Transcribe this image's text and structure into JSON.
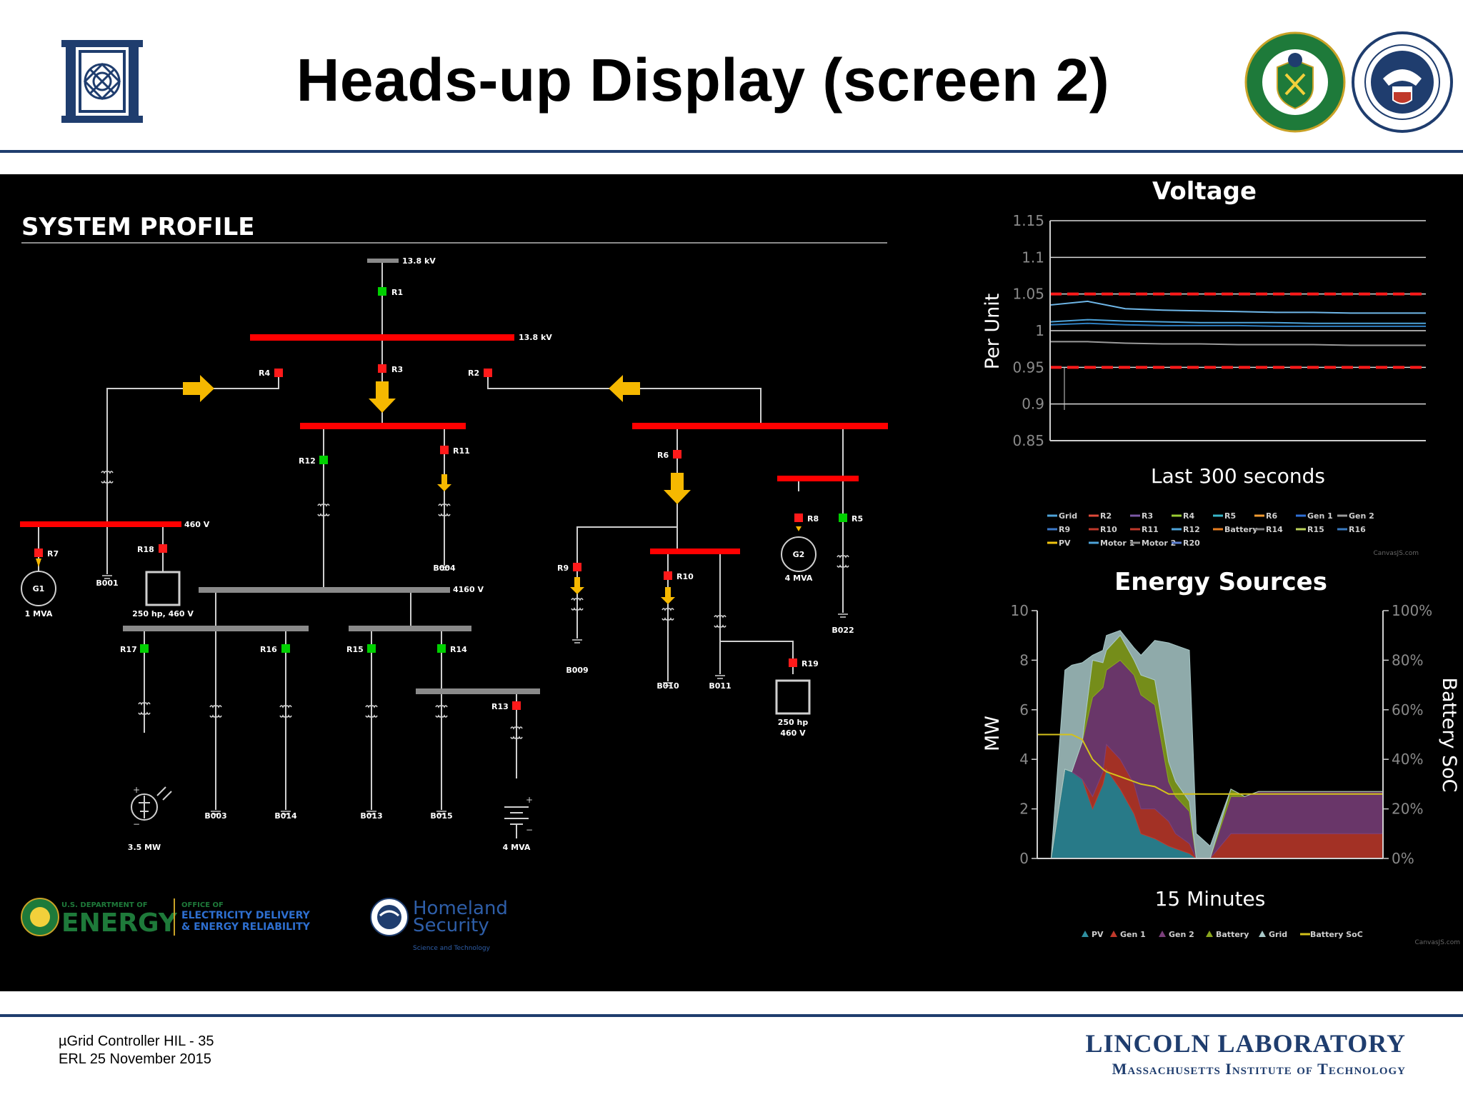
{
  "slide": {
    "title": "Heads-up Display (screen 2)",
    "footer_line1": "µGrid Controller HIL - 35",
    "footer_line2": "ERL 25 November 2015",
    "lab_name": "LINCOLN LABORATORY",
    "lab_subtitle": "Massachusetts Institute of Technology"
  },
  "colors": {
    "accent_navy": "#1f3d6e",
    "bus_energized": "#ff0000",
    "bus_deenergized": "#8a8a8a",
    "breaker_closed": "#00d000",
    "breaker_open": "#ff1a1a",
    "flow_arrow": "#f5b800"
  },
  "system_profile": {
    "title": "SYSTEM PROFILE",
    "labels": {
      "kv138_top": "13.8 kV",
      "kv138_main": "13.8 kV",
      "v460": "460 V",
      "v4160": "4160 V",
      "g1": "G1",
      "g1_rating": "1 MVA",
      "g2": "G2",
      "g2_rating": "4 MVA",
      "motor1_rating": "250 hp, 460 V",
      "motor2_rating_l1": "250 hp",
      "motor2_rating_l2": "460 V",
      "pv_rating": "3.5 MW",
      "batt_rating": "4 MVA"
    },
    "breakers": {
      "R1": "R1",
      "R2": "R2",
      "R3": "R3",
      "R4": "R4",
      "R5": "R5",
      "R6": "R6",
      "R7": "R7",
      "R8": "R8",
      "R9": "R9",
      "R10": "R10",
      "R11": "R11",
      "R12": "R12",
      "R13": "R13",
      "R14": "R14",
      "R15": "R15",
      "R16": "R16",
      "R17": "R17",
      "R18": "R18",
      "R19": "R19"
    },
    "loads": {
      "B001": "B001",
      "B003": "B003",
      "B004": "B004",
      "B009": "B009",
      "B010": "B010",
      "B011": "B011",
      "B013": "B013",
      "B014": "B014",
      "B015": "B015",
      "B022": "B022"
    },
    "logos": {
      "doe_small": "U.S. DEPARTMENT OF",
      "doe_big": "ENERGY",
      "oe_l1": "OFFICE OF",
      "oe_l2": "ELECTRICITY DELIVERY",
      "oe_l3": "& ENERGY RELIABILITY",
      "dhs_l1": "Homeland",
      "dhs_l2": "Security",
      "dhs_l3": "Science and Technology"
    }
  },
  "chart_data": [
    {
      "type": "line",
      "title": "Voltage",
      "xlabel": "Last 300 seconds",
      "ylabel": "Per Unit",
      "ylim": [
        0.85,
        1.15
      ],
      "yticks": [
        "1.15",
        "1.1",
        "1.05",
        "1",
        "0.95",
        "0.9",
        "0.85"
      ],
      "limits": [
        1.05,
        0.95
      ],
      "legend": [
        "Grid",
        "R2",
        "R3",
        "R4",
        "R5",
        "R6",
        "Gen 1",
        "Gen 2",
        "R9",
        "R10",
        "R11",
        "R12",
        "Battery",
        "R14",
        "R15",
        "R16",
        "PV",
        "Motor 1",
        "Motor 2",
        "R20"
      ],
      "legend_colors": [
        "#4ea3d9",
        "#e04a3a",
        "#7b59a6",
        "#9acd32",
        "#39b6c9",
        "#f39c32",
        "#2f6fd6",
        "#9a9a9a",
        "#3c78c8",
        "#c0392b",
        "#c0392b",
        "#4ea3d9",
        "#e67e22",
        "#7f7f7f",
        "#bcd35b",
        "#3a7ac0",
        "#f1c40f",
        "#4ea3d9",
        "#888888",
        "#5d7fd0"
      ],
      "series": [
        {
          "values": [
            1.035,
            1.04,
            1.03,
            1.028,
            1.027,
            1.026,
            1.025,
            1.025,
            1.024,
            1.024,
            1.024
          ]
        },
        {
          "values": [
            1.012,
            1.015,
            1.013,
            1.012,
            1.011,
            1.011,
            1.011,
            1.01,
            1.01,
            1.01,
            1.01
          ]
        },
        {
          "values": [
            1.008,
            1.01,
            1.008,
            1.007,
            1.007,
            1.007,
            1.006,
            1.006,
            1.006,
            1.006,
            1.006
          ]
        },
        {
          "values": [
            0.985,
            0.985,
            0.983,
            0.982,
            0.982,
            0.981,
            0.981,
            0.981,
            0.98,
            0.98,
            0.98
          ]
        }
      ],
      "credit": "CanvasJS.com"
    },
    {
      "type": "area",
      "title": "Energy Sources",
      "xlabel": "15 Minutes",
      "ylabel": "MW",
      "y2label": "Battery SoC",
      "ylim": [
        0,
        10
      ],
      "yticks": [
        "0",
        "2",
        "4",
        "6",
        "8",
        "10"
      ],
      "y2ticks": [
        "0%",
        "20%",
        "40%",
        "60%",
        "80%",
        "100%"
      ],
      "legend": [
        "PV",
        "Gen 1",
        "Gen 2",
        "Battery",
        "Grid",
        "Battery SoC"
      ],
      "legend_colors": [
        "#2f8fa0",
        "#c0392b",
        "#7b3f7b",
        "#8aa61e",
        "#a8c8c8",
        "#d4c21a"
      ],
      "x": [
        0,
        4,
        8,
        10,
        13,
        16,
        19,
        20,
        24,
        28,
        30,
        34,
        38,
        40,
        44,
        46,
        50,
        56,
        60,
        62,
        64,
        70,
        80,
        90,
        100
      ],
      "series": [
        {
          "name": "PV",
          "values": [
            0,
            0,
            3.6,
            3.5,
            3.2,
            2.0,
            3.0,
            3.6,
            2.8,
            1.8,
            1.0,
            0.8,
            0.5,
            0.4,
            0.2,
            0,
            0,
            0,
            0,
            0,
            0,
            0,
            0,
            0,
            0
          ]
        },
        {
          "name": "Gen 1",
          "values": [
            0,
            0,
            0,
            0,
            0,
            0.5,
            0.5,
            1.0,
            1.2,
            1.2,
            1.0,
            1.2,
            1.0,
            0.6,
            0.4,
            0,
            0,
            1.0,
            1.0,
            1.0,
            1.0,
            1.0,
            1.0,
            1.0,
            1.0
          ]
        },
        {
          "name": "Gen 2",
          "values": [
            0,
            0,
            0,
            0,
            1.5,
            4.0,
            3.4,
            3.0,
            4.0,
            4.4,
            4.6,
            4.2,
            1.6,
            1.5,
            1.3,
            0,
            0,
            1.5,
            1.5,
            1.6,
            1.7,
            1.7,
            1.7,
            1.7,
            1.7
          ]
        },
        {
          "name": "Battery",
          "values": [
            0,
            0,
            0,
            0,
            0,
            1.5,
            1.0,
            0.8,
            1.0,
            0.6,
            0.8,
            1.0,
            0.8,
            0.6,
            0.4,
            0,
            0,
            0.3,
            0,
            0,
            0,
            0,
            0,
            0,
            0
          ]
        },
        {
          "name": "Grid",
          "values": [
            0,
            0,
            4.0,
            4.3,
            3.2,
            0.2,
            0.5,
            0.6,
            0.2,
            0.5,
            0.8,
            1.6,
            4.8,
            5.5,
            6.1,
            1.0,
            0.5,
            0,
            0,
            0,
            0,
            0,
            0,
            0,
            0
          ]
        },
        {
          "name": "Battery SoC",
          "axis": "right",
          "values": [
            50,
            50,
            50,
            50,
            48,
            40,
            36,
            35,
            33,
            31,
            30,
            29,
            26,
            26,
            26,
            26,
            26,
            26,
            26,
            26,
            26,
            26,
            26,
            26,
            26
          ]
        }
      ],
      "credit": "CanvasJS.com"
    }
  ]
}
